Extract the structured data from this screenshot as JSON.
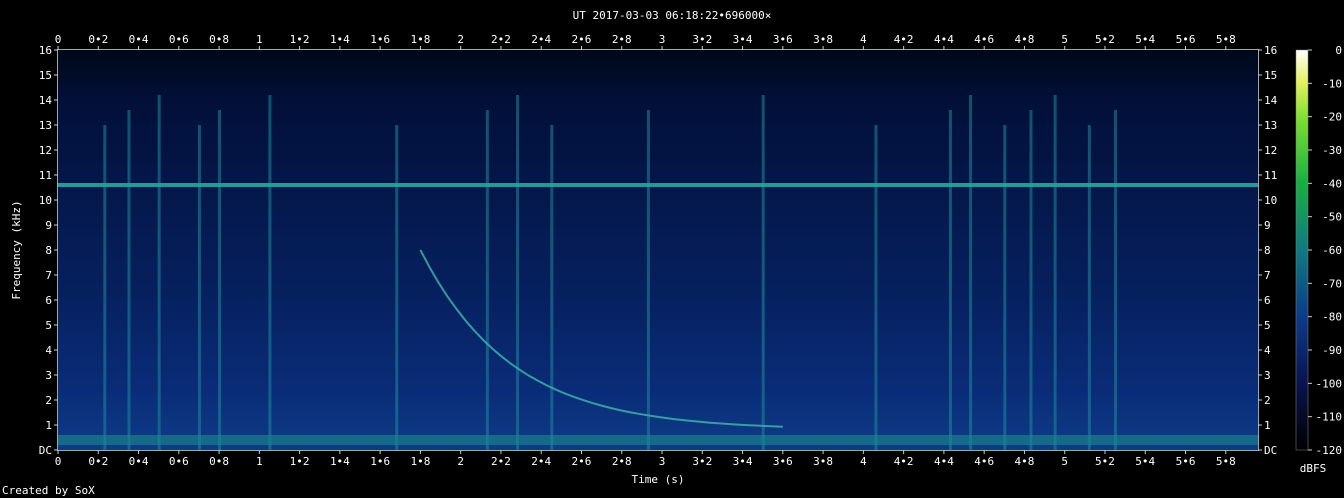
{
  "chart_data": {
    "type": "heatmap",
    "title": "UT 2017-03-03 06:18:22•696000×",
    "xlabel": "Time (s)",
    "ylabel": "Frequency (kHz)",
    "xlim": [
      0,
      5.96
    ],
    "ylim": [
      0,
      16
    ],
    "x_ticks": [
      "0",
      "0•2",
      "0•4",
      "0•6",
      "0•8",
      "1",
      "1•2",
      "1•4",
      "1•6",
      "1•8",
      "2",
      "2•2",
      "2•4",
      "2•6",
      "2•8",
      "3",
      "3•2",
      "3•4",
      "3•6",
      "3•8",
      "4",
      "4•2",
      "4•4",
      "4•6",
      "4•8",
      "5",
      "5•2",
      "5•4",
      "5•6",
      "5•8"
    ],
    "y_ticks": [
      "DC",
      "1",
      "2",
      "3",
      "4",
      "5",
      "6",
      "7",
      "8",
      "9",
      "10",
      "11",
      "12",
      "13",
      "14",
      "15",
      "16"
    ],
    "colorbar": {
      "label": "dBFS",
      "ticks": [
        "0",
        "-10",
        "-20",
        "-30",
        "-40",
        "-50",
        "-60",
        "-70",
        "-80",
        "-90",
        "-100",
        "-110",
        "-120"
      ],
      "range": [
        -120,
        0
      ]
    },
    "features": {
      "tone_khz": 10.6,
      "low_band_khz": [
        0.2,
        0.6
      ],
      "whistler": {
        "start_s": 1.8,
        "end_s": 3.6,
        "start_khz": 8.0,
        "end_khz": 0.8
      },
      "impulse_times_s": [
        0.23,
        0.35,
        0.5,
        0.7,
        0.8,
        1.05,
        1.68,
        2.13,
        2.28,
        2.45,
        2.93,
        3.5,
        4.06,
        4.43,
        4.53,
        4.7,
        4.83,
        4.95,
        5.12,
        5.25
      ]
    },
    "footer": "Created by SoX"
  }
}
